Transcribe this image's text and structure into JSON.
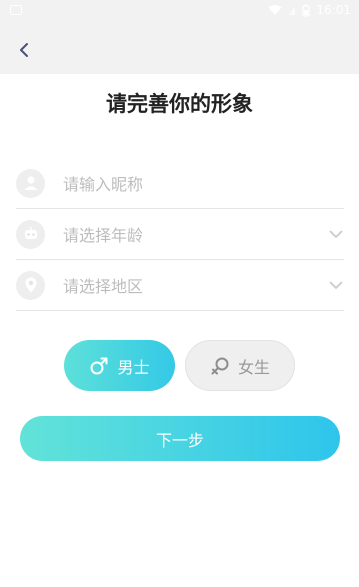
{
  "status_bar": {
    "time": "16:01"
  },
  "header": {
    "back_icon": "chevron-left-icon"
  },
  "page": {
    "title": "请完善你的形象"
  },
  "form": {
    "nickname": {
      "placeholder": "请输入昵称",
      "icon": "person-icon"
    },
    "age": {
      "placeholder": "请选择年龄",
      "icon": "robot-face-icon"
    },
    "region": {
      "placeholder": "请选择地区",
      "icon": "location-pin-icon"
    }
  },
  "gender": {
    "male_label": "男士",
    "female_label": "女生",
    "selected": "male"
  },
  "next_button": {
    "label": "下一步"
  },
  "colors": {
    "accent_start": "#5de0d9",
    "accent_end": "#2ec5ec",
    "title": "#222222",
    "placeholder": "#bdbdbd"
  }
}
